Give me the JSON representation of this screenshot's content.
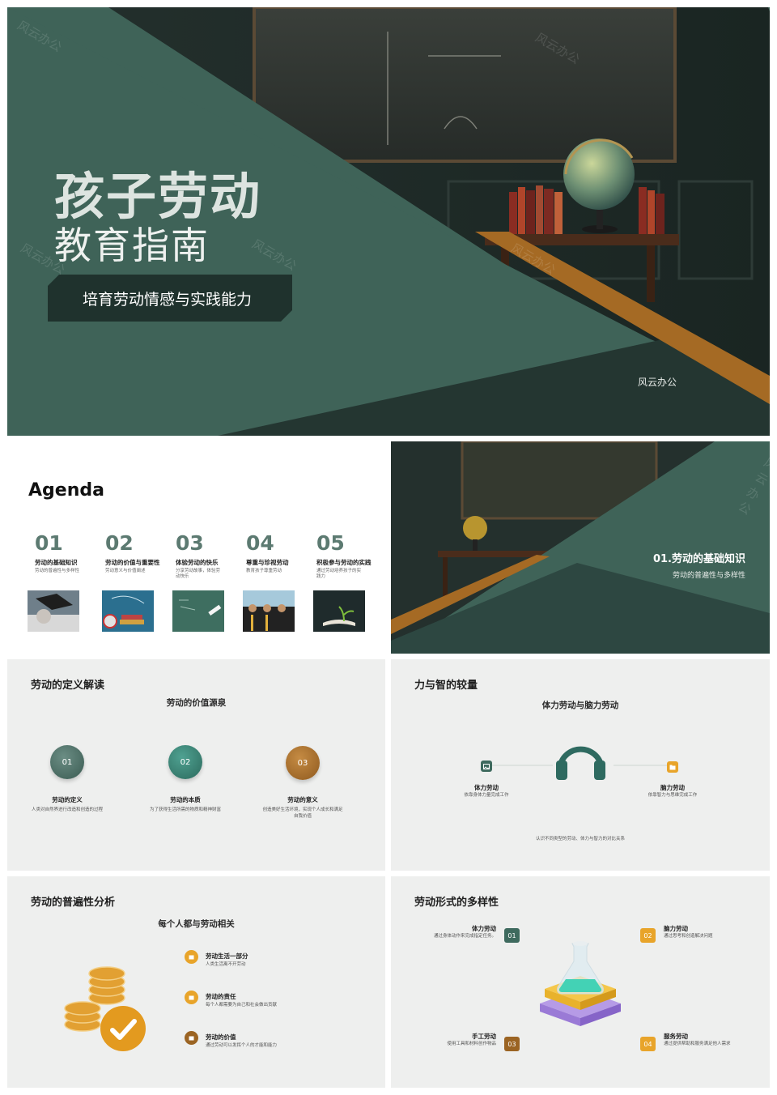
{
  "cover": {
    "title_line1": "孩子劳动",
    "title_line2": "教育指南",
    "subtitle": "培育劳动情感与实践能力",
    "brand": "风云办公",
    "watermark": "风云办公"
  },
  "agenda": {
    "title": "Agenda",
    "items": [
      {
        "num": "01",
        "title": "劳动的基础知识",
        "desc": "劳动的普遍性与多样性"
      },
      {
        "num": "02",
        "title": "劳动的价值与重要性",
        "desc": "劳动意义与价值阐述"
      },
      {
        "num": "03",
        "title": "体验劳动的快乐",
        "desc": "分享劳动故事，体验劳动快乐"
      },
      {
        "num": "04",
        "title": "尊重与珍视劳动",
        "desc": "教育孩子尊重劳动"
      },
      {
        "num": "05",
        "title": "积极参与劳动的实践",
        "desc": "通过劳动培养孩子的实践力"
      }
    ]
  },
  "section1": {
    "title": "01.劳动的基础知识",
    "subtitle": "劳动的普遍性与多样性"
  },
  "definition": {
    "title": "劳动的定义解读",
    "heading": "劳动的价值源泉",
    "items": [
      {
        "num": "01",
        "title": "劳动的定义",
        "desc": "人类对自然界进行改造和创造的过程"
      },
      {
        "num": "02",
        "title": "劳动的本质",
        "desc": "为了获得生活所需的物质和精神财富"
      },
      {
        "num": "03",
        "title": "劳动的意义",
        "desc": "创造美好生活环境，实现个人成长和满足自我价值"
      }
    ]
  },
  "compare": {
    "title": "力与智的较量",
    "heading": "体力劳动与脑力劳动",
    "left": {
      "title": "体力劳动",
      "desc": "依靠身体力量完成工作"
    },
    "right": {
      "title": "脑力劳动",
      "desc": "依靠智力与思维完成工作"
    },
    "note": "认识不同类型的劳动、体力与智力的对比关系"
  },
  "universality": {
    "title": "劳动的普遍性分析",
    "heading": "每个人都与劳动相关",
    "items": [
      {
        "title": "劳动生活一部分",
        "desc": "人类生活离不开劳动"
      },
      {
        "title": "劳动的责任",
        "desc": "每个人都需要为自己和社会做出贡献"
      },
      {
        "title": "劳动的价值",
        "desc": "通过劳动可以发挥个人的才能和能力"
      }
    ]
  },
  "diversity": {
    "title": "劳动形式的多样性",
    "items": [
      {
        "num": "01",
        "title": "体力劳动",
        "desc": "通过身体动作来完成指定任务。"
      },
      {
        "num": "02",
        "title": "脑力劳动",
        "desc": "通过思考和创造解决问题"
      },
      {
        "num": "03",
        "title": "手工劳动",
        "desc": "使用工具和材料创作物品"
      },
      {
        "num": "04",
        "title": "服务劳动",
        "desc": "通过提供帮助和服务满足他人需求"
      }
    ]
  },
  "colors": {
    "green": "#3f6358",
    "dark_green": "#1f322d",
    "bronze": "#a56a24",
    "amber": "#e8a42a"
  }
}
